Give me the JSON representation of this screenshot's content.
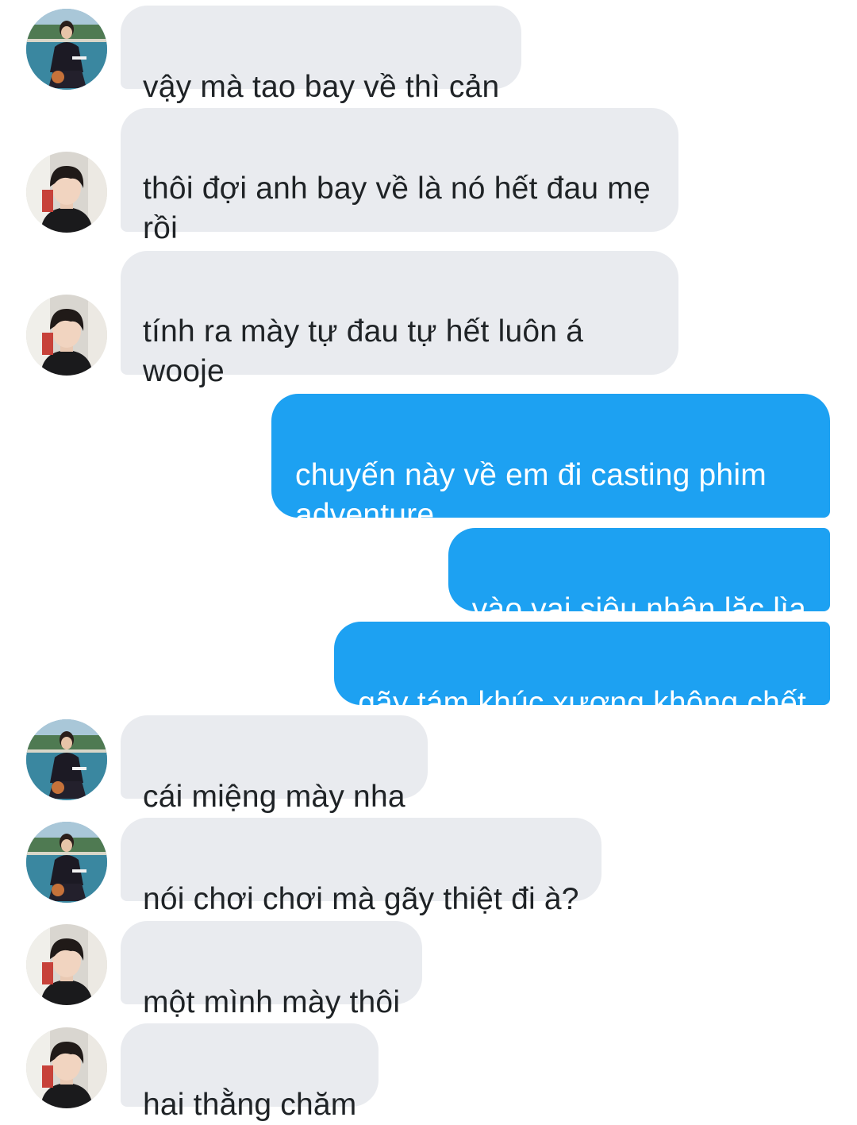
{
  "colors": {
    "incoming_bubble": "#e9ebef",
    "incoming_text": "#1f2326",
    "outgoing_bubble": "#1da1f2",
    "outgoing_text": "#ffffff"
  },
  "messages": [
    {
      "direction": "incoming",
      "avatar": "avatar-court-photo",
      "text": "vậy mà tao bay về thì cản"
    },
    {
      "direction": "incoming",
      "avatar": "avatar-portrait-photo",
      "text": "thôi đợi anh bay về là nó hết đau mẹ rồi"
    },
    {
      "direction": "incoming",
      "avatar": "avatar-portrait-photo",
      "text": "tính ra mày tự đau tự hết luôn á wooje"
    },
    {
      "direction": "outgoing",
      "text": "chuyến này về em đi casting phim adventure"
    },
    {
      "direction": "outgoing",
      "text": "vào vai siêu nhân lặc lìa"
    },
    {
      "direction": "outgoing",
      "text": "gãy tám khúc xương không chết"
    },
    {
      "direction": "incoming",
      "avatar": "avatar-court-photo",
      "text": "cái miệng mày nha"
    },
    {
      "direction": "incoming",
      "avatar": "avatar-court-photo",
      "text": "nói chơi chơi mà gãy thiệt đi à?"
    },
    {
      "direction": "incoming",
      "avatar": "avatar-portrait-photo",
      "text": "một mình mày thôi"
    },
    {
      "direction": "incoming",
      "avatar": "avatar-portrait-photo",
      "text": "hai thằng chăm"
    }
  ]
}
